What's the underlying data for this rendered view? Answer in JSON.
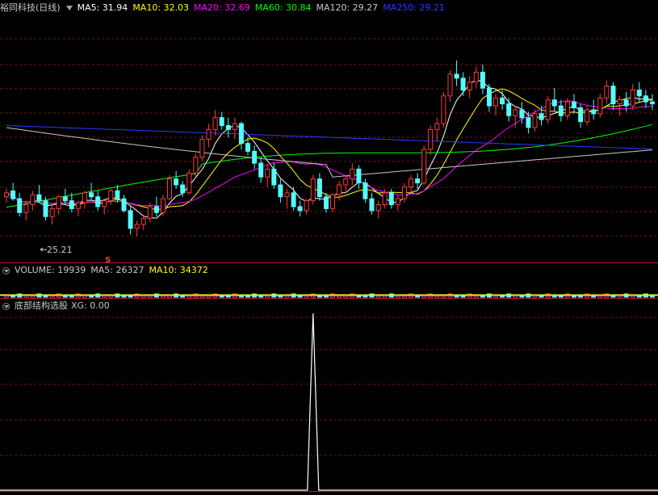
{
  "colors": {
    "up": "#ff3a3a",
    "down": "#54fcfc",
    "grid": "#7a1414",
    "ma5": "#ffffff",
    "ma10": "#ffff00",
    "ma20": "#ff00ff",
    "ma60": "#00ff00",
    "ma120": "#c8c8c8",
    "ma250": "#2a3cff",
    "xg": "#ffffff"
  },
  "header": {
    "title": "裕同科技(日线)",
    "ma5": "MA5: 31.94",
    "ma10": "MA10: 32.03",
    "ma20": "MA20: 32.69",
    "ma60": "MA60: 30.84",
    "ma120": "MA120: 29.27",
    "ma250": "MA250: 29.21"
  },
  "volume_header": {
    "volume": "VOLUME: 19939",
    "ma5": "MA5: 26327",
    "ma10": "MA10: 34372"
  },
  "indicator_header": {
    "name": "底部结构选股",
    "xg": "XG: 0.00"
  },
  "annotations": {
    "low_label": "25.21",
    "low_marker": "S"
  },
  "chart_data": [
    {
      "type": "candlestick",
      "title": "裕同科技(日线)",
      "ylim": [
        24.0,
        36.5
      ],
      "ohlc": [
        [
          27.2,
          27.6,
          26.9,
          27.4
        ],
        [
          27.5,
          27.9,
          27.0,
          27.1
        ],
        [
          27.1,
          27.4,
          26.2,
          26.4
        ],
        [
          26.4,
          27.0,
          26.0,
          26.8
        ],
        [
          26.8,
          27.5,
          26.5,
          27.3
        ],
        [
          27.3,
          27.8,
          26.9,
          27.0
        ],
        [
          27.0,
          27.2,
          26.0,
          26.2
        ],
        [
          26.2,
          26.8,
          25.8,
          26.6
        ],
        [
          26.6,
          27.3,
          26.3,
          27.2
        ],
        [
          27.2,
          27.6,
          26.8,
          27.0
        ],
        [
          27.0,
          27.4,
          26.4,
          26.6
        ],
        [
          26.6,
          27.0,
          26.2,
          26.9
        ],
        [
          26.9,
          27.5,
          26.6,
          27.4
        ],
        [
          27.4,
          27.9,
          27.0,
          27.2
        ],
        [
          27.2,
          27.5,
          26.5,
          26.7
        ],
        [
          26.7,
          27.1,
          26.3,
          27.0
        ],
        [
          27.0,
          27.6,
          26.8,
          27.5
        ],
        [
          27.5,
          27.8,
          26.9,
          27.1
        ],
        [
          27.1,
          27.3,
          26.4,
          26.5
        ],
        [
          26.5,
          26.7,
          25.3,
          25.6
        ],
        [
          25.6,
          26.0,
          25.2,
          25.8
        ],
        [
          25.8,
          26.3,
          25.5,
          26.1
        ],
        [
          26.1,
          26.9,
          25.9,
          26.7
        ],
        [
          26.7,
          27.2,
          26.2,
          26.4
        ],
        [
          26.4,
          27.3,
          26.2,
          27.1
        ],
        [
          27.1,
          28.3,
          27.0,
          28.1
        ],
        [
          28.1,
          28.5,
          27.6,
          27.8
        ],
        [
          27.8,
          28.0,
          27.2,
          27.4
        ],
        [
          27.4,
          28.6,
          27.3,
          28.4
        ],
        [
          28.4,
          29.4,
          28.2,
          29.2
        ],
        [
          29.2,
          30.3,
          29.0,
          30.1
        ],
        [
          30.1,
          30.9,
          29.7,
          30.6
        ],
        [
          30.6,
          31.6,
          30.3,
          31.2
        ],
        [
          31.2,
          31.5,
          30.6,
          30.8
        ],
        [
          30.8,
          31.2,
          30.2,
          30.6
        ],
        [
          30.6,
          31.2,
          30.1,
          30.9
        ],
        [
          30.9,
          31.0,
          29.6,
          29.9
        ],
        [
          29.9,
          30.2,
          29.3,
          29.5
        ],
        [
          29.5,
          29.8,
          28.6,
          28.9
        ],
        [
          28.9,
          29.2,
          27.9,
          28.2
        ],
        [
          28.2,
          28.8,
          27.7,
          28.6
        ],
        [
          28.6,
          28.9,
          27.6,
          27.8
        ],
        [
          27.8,
          28.1,
          26.9,
          27.2
        ],
        [
          27.2,
          27.6,
          26.6,
          27.4
        ],
        [
          27.4,
          27.7,
          26.5,
          26.7
        ],
        [
          26.7,
          27.0,
          26.2,
          26.5
        ],
        [
          26.5,
          27.1,
          26.3,
          27.0
        ],
        [
          27.0,
          28.3,
          26.8,
          28.1
        ],
        [
          28.1,
          28.4,
          27.0,
          27.2
        ],
        [
          27.2,
          27.4,
          26.4,
          26.6
        ],
        [
          26.6,
          27.4,
          26.4,
          27.3
        ],
        [
          27.3,
          28.0,
          27.0,
          27.8
        ],
        [
          27.8,
          28.3,
          27.4,
          28.1
        ],
        [
          28.1,
          28.9,
          27.8,
          28.6
        ],
        [
          28.6,
          28.8,
          27.6,
          27.9
        ],
        [
          27.9,
          28.1,
          26.9,
          27.1
        ],
        [
          27.1,
          27.4,
          26.3,
          26.5
        ],
        [
          26.5,
          27.0,
          26.1,
          26.8
        ],
        [
          26.8,
          27.6,
          26.6,
          27.4
        ],
        [
          27.4,
          27.6,
          26.6,
          26.8
        ],
        [
          26.8,
          27.3,
          26.5,
          27.1
        ],
        [
          27.1,
          27.9,
          26.9,
          27.7
        ],
        [
          27.7,
          28.3,
          27.4,
          28.1
        ],
        [
          28.1,
          28.4,
          27.6,
          27.9
        ],
        [
          27.9,
          29.8,
          27.8,
          29.6
        ],
        [
          29.6,
          30.8,
          29.3,
          30.6
        ],
        [
          30.6,
          31.2,
          30.0,
          30.9
        ],
        [
          30.9,
          32.5,
          30.7,
          32.3
        ],
        [
          32.3,
          33.6,
          32.0,
          33.4
        ],
        [
          33.4,
          34.1,
          32.8,
          33.2
        ],
        [
          33.2,
          33.5,
          32.3,
          32.6
        ],
        [
          32.6,
          33.3,
          32.2,
          33.0
        ],
        [
          33.0,
          33.8,
          32.7,
          33.5
        ],
        [
          33.5,
          33.9,
          32.4,
          32.7
        ],
        [
          32.7,
          32.9,
          31.5,
          31.8
        ],
        [
          31.8,
          32.4,
          31.3,
          32.2
        ],
        [
          32.2,
          32.6,
          31.6,
          31.9
        ],
        [
          31.9,
          32.2,
          31.0,
          31.3
        ],
        [
          31.3,
          31.8,
          30.7,
          31.6
        ],
        [
          31.6,
          32.0,
          30.9,
          31.2
        ],
        [
          31.2,
          31.5,
          30.4,
          30.7
        ],
        [
          30.7,
          31.6,
          30.5,
          31.4
        ],
        [
          31.4,
          31.8,
          30.8,
          31.1
        ],
        [
          31.1,
          32.3,
          30.9,
          32.1
        ],
        [
          32.1,
          32.7,
          31.5,
          31.8
        ],
        [
          31.8,
          32.1,
          31.0,
          31.3
        ],
        [
          31.3,
          32.2,
          31.1,
          32.0
        ],
        [
          32.0,
          32.4,
          31.4,
          31.7
        ],
        [
          31.7,
          31.9,
          30.7,
          31.0
        ],
        [
          31.0,
          31.8,
          30.8,
          31.6
        ],
        [
          31.6,
          32.1,
          31.1,
          31.4
        ],
        [
          31.4,
          32.4,
          31.2,
          32.2
        ],
        [
          32.2,
          33.1,
          31.9,
          32.8
        ],
        [
          32.8,
          33.0,
          31.6,
          31.9
        ],
        [
          31.9,
          32.3,
          31.3,
          32.1
        ],
        [
          32.1,
          32.5,
          31.5,
          31.8
        ],
        [
          31.8,
          32.9,
          31.6,
          32.6
        ],
        [
          32.6,
          33.0,
          32.0,
          32.3
        ],
        [
          32.3,
          32.6,
          31.7,
          32.0
        ],
        [
          32.0,
          32.4,
          31.6,
          31.9
        ]
      ]
    },
    {
      "type": "bar",
      "title": "VOLUME",
      "values": [
        19939
      ],
      "series": [
        {
          "name": "MA5",
          "values": [
            26327
          ]
        },
        {
          "name": "MA10",
          "values": [
            34372
          ]
        }
      ]
    },
    {
      "type": "line",
      "title": "底部结构选股",
      "series": [
        {
          "name": "XG",
          "peak_index": 47,
          "values": [
            0.0
          ]
        }
      ]
    }
  ]
}
